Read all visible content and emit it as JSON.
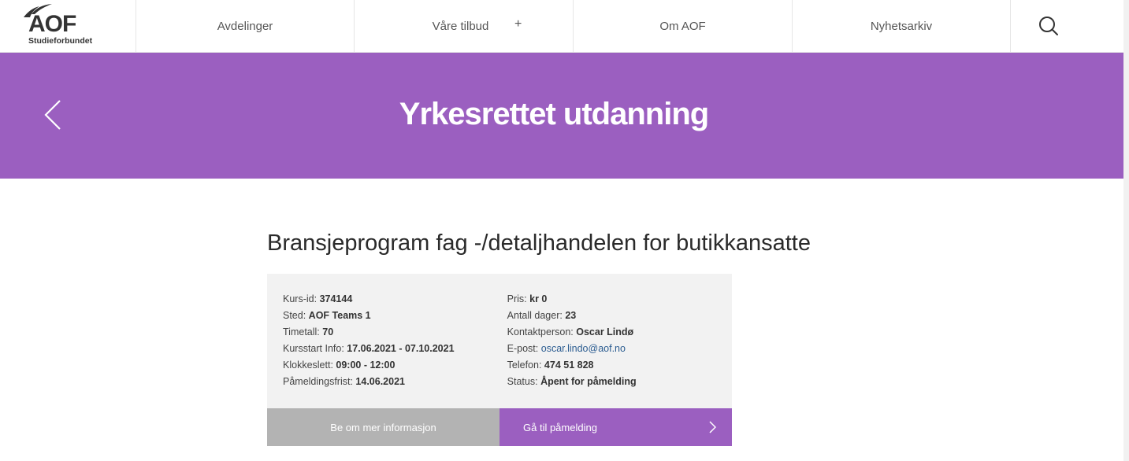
{
  "brand": {
    "logo_text": "AOF",
    "logo_sub": "Studieforbundet"
  },
  "nav": {
    "items": [
      {
        "label": "Avdelinger"
      },
      {
        "label": "Våre tilbud",
        "expander": "+"
      },
      {
        "label": "Om AOF"
      },
      {
        "label": "Nyhetsarkiv"
      }
    ],
    "search_icon": "search-icon"
  },
  "banner": {
    "title": "Yrkesrettet utdanning",
    "back_icon": "chevron-left-icon"
  },
  "course": {
    "title": "Bransjeprogram fag -/detaljhandelen for butikkansatte",
    "left": [
      {
        "label": "Kurs-id:",
        "value": "374144"
      },
      {
        "label": "Sted:",
        "value": "AOF Teams 1"
      },
      {
        "label": "Timetall:",
        "value": "70"
      },
      {
        "label": "Kursstart Info:",
        "value": "17.06.2021 - 07.10.2021"
      },
      {
        "label": "Klokkeslett:",
        "value": "09:00 - 12:00"
      },
      {
        "label": "Påmeldingsfrist:",
        "value": "14.06.2021"
      }
    ],
    "right": [
      {
        "label": "Pris:",
        "value": "kr 0"
      },
      {
        "label": "Antall dager:",
        "value": "23"
      },
      {
        "label": "Kontaktperson:",
        "value": "Oscar Lindø"
      },
      {
        "label": "E-post:",
        "link": "oscar.lindo@aof.no"
      },
      {
        "label": "Telefon:",
        "value": "474 51 828"
      },
      {
        "label": "Status:",
        "value": "Åpent for påmelding"
      }
    ],
    "buttons": {
      "info": "Be om mer informasjon",
      "signup": "Gå til påmelding"
    }
  },
  "colors": {
    "accent": "#9b5fc0",
    "info_box": "#f2f2f2",
    "secondary_button": "#b3b3b3",
    "link": "#2c5d91"
  }
}
